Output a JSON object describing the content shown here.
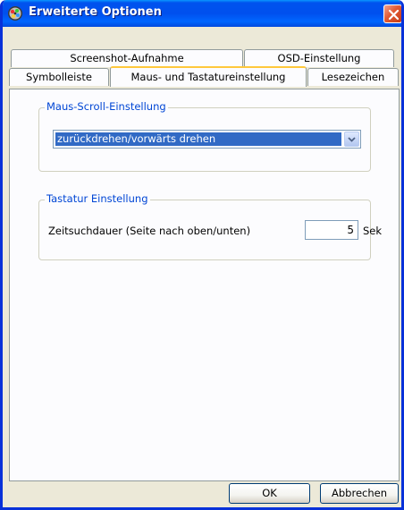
{
  "window": {
    "title": "Erweiterte Optionen"
  },
  "tabs": {
    "row1": [
      {
        "label": "Screenshot-Aufnahme"
      },
      {
        "label": "OSD-Einstellung"
      }
    ],
    "row2": [
      {
        "label": "Symbolleiste"
      },
      {
        "label": "Maus- und Tastatureinstellung",
        "active": true
      },
      {
        "label": "Lesezeichen"
      }
    ]
  },
  "mouse_group": {
    "title": "Maus-Scroll-Einstellung",
    "dropdown_value": "zurückdrehen/vorwärts drehen"
  },
  "keyboard_group": {
    "title": "Tastatur Einstellung",
    "field_label": "Zeitsuchdauer (Seite nach oben/unten)",
    "field_value": "5",
    "unit": "Sek"
  },
  "buttons": {
    "ok": "OK",
    "cancel": "Abbrechen"
  },
  "colors": {
    "titlebar": "#0053ee",
    "dialog_bg": "#ece9d8",
    "group_title": "#0046d5",
    "selection": "#316ac5",
    "active_tab_accent": "#ffc83c",
    "close_button": "#e25a33"
  },
  "icons": {
    "app": "app-icon",
    "close": "close-icon",
    "dropdown": "chevron-down-icon"
  }
}
